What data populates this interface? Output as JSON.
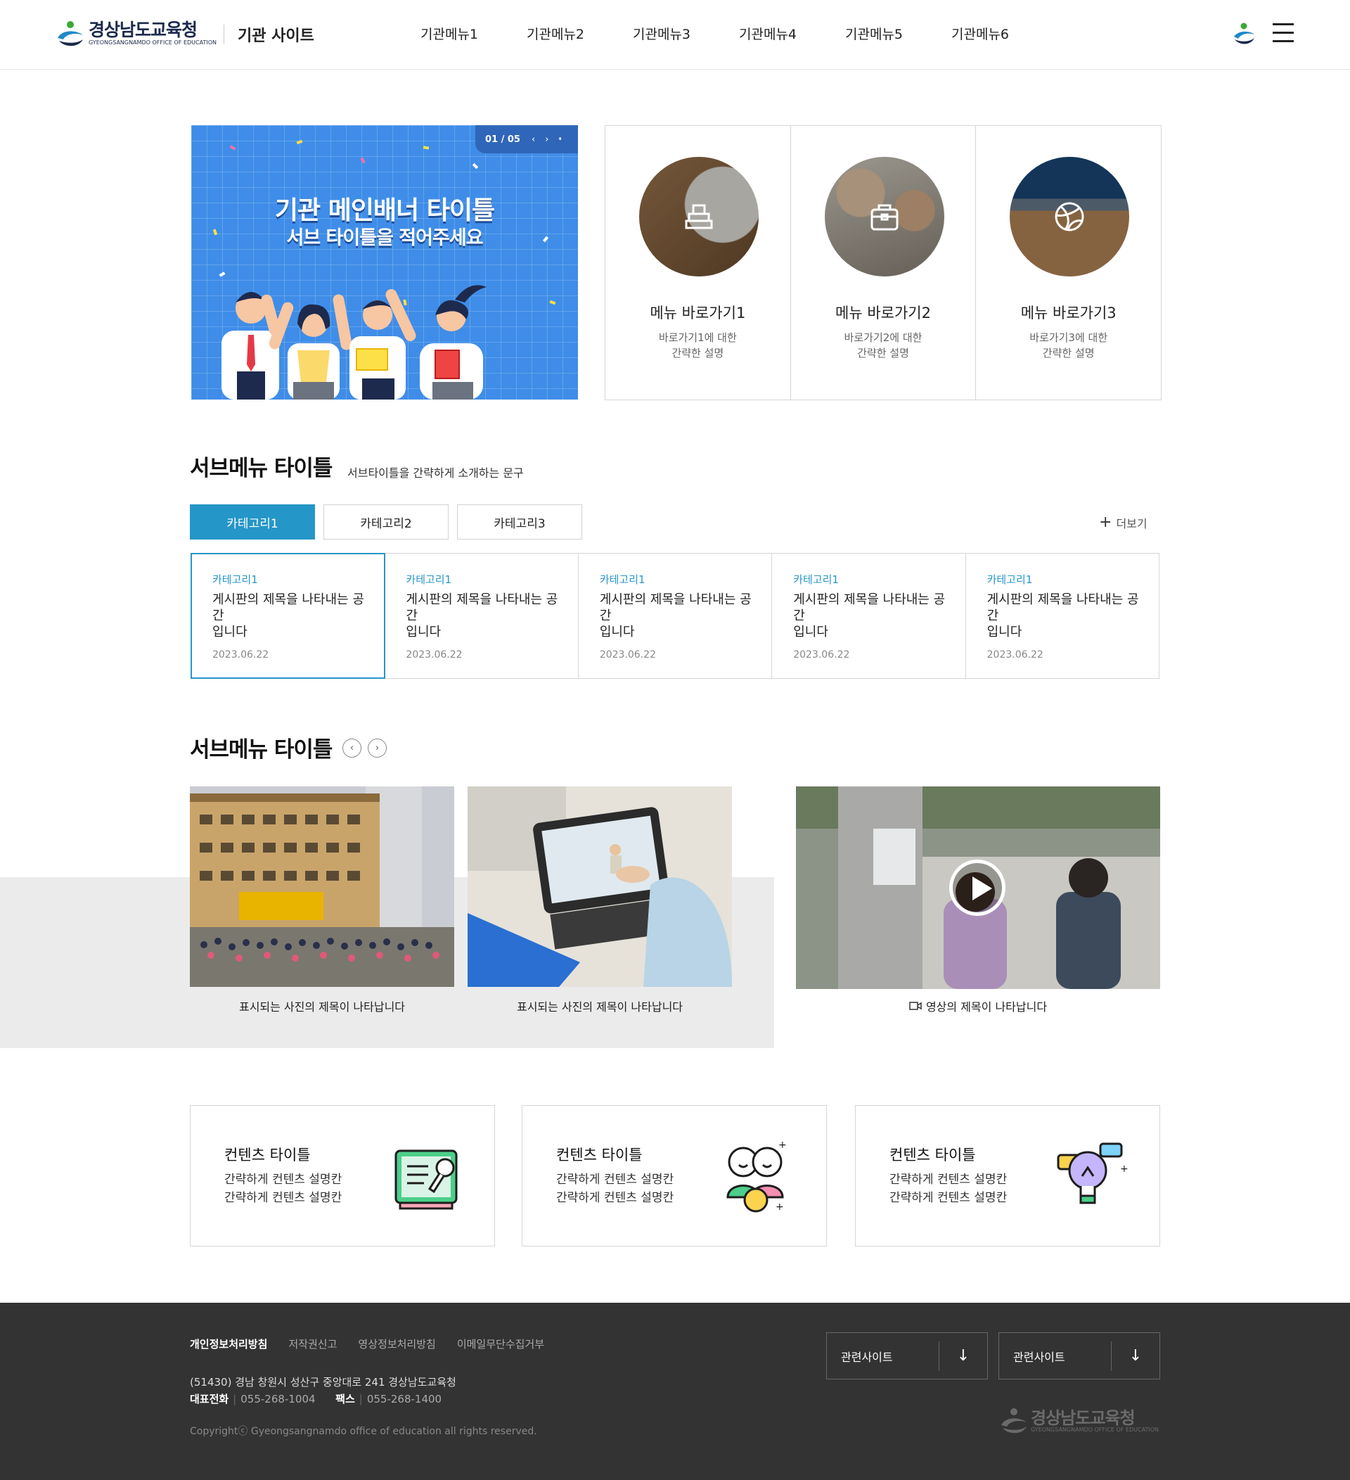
{
  "header": {
    "logo_ko": "경상남도교육청",
    "logo_en": "GYEONGSANGNAMDO OFFICE OF EDUCATION",
    "site_name": "기관 사이트",
    "gnb": [
      "기관메뉴1",
      "기관메뉴2",
      "기관메뉴3",
      "기관메뉴4",
      "기관메뉴5",
      "기관메뉴6"
    ]
  },
  "banner": {
    "page": "01 / 05",
    "prev_icon": "‹",
    "next_icon": "›",
    "pause_icon": "⏸",
    "title": "기관 메인배너 타이틀",
    "subtitle": "서브 타이틀을 적어주세요"
  },
  "quick_menu": [
    {
      "title": "메뉴 바로가기1",
      "desc_line1": "바로가기1에 대한",
      "desc_line2": "간략한 설명",
      "icon": "books-icon"
    },
    {
      "title": "메뉴 바로가기2",
      "desc_line1": "바로가기2에 대한",
      "desc_line2": "간략한 설명",
      "icon": "bag-icon"
    },
    {
      "title": "메뉴 바로가기3",
      "desc_line1": "바로가기3에 대한",
      "desc_line2": "간략한 설명",
      "icon": "ball-icon"
    }
  ],
  "board": {
    "title": "서브메뉴 타이틀",
    "desc": "서브타이틀을 간략하게 소개하는 문구",
    "tabs": [
      "카테고리1",
      "카테고리2",
      "카테고리3"
    ],
    "active_tab": 0,
    "more_label": "더보기",
    "posts": [
      {
        "category": "카테고리1",
        "title_line1": "게시판의 제목을 나타내는 공간",
        "title_line2": "입니다",
        "date": "2023.06.22"
      },
      {
        "category": "카테고리1",
        "title_line1": "게시판의 제목을 나타내는 공간",
        "title_line2": "입니다",
        "date": "2023.06.22"
      },
      {
        "category": "카테고리1",
        "title_line1": "게시판의 제목을 나타내는 공간",
        "title_line2": "입니다",
        "date": "2023.06.22"
      },
      {
        "category": "카테고리1",
        "title_line1": "게시판의 제목을 나타내는 공간",
        "title_line2": "입니다",
        "date": "2023.06.22"
      },
      {
        "category": "카테고리1",
        "title_line1": "게시판의 제목을 나타내는 공간",
        "title_line2": "입니다",
        "date": "2023.06.22"
      }
    ]
  },
  "gallery": {
    "title": "서브메뉴 타이틀",
    "prev": "‹",
    "next": "›",
    "photos": [
      {
        "caption": "표시되는 사진의 제목이 나타납니다"
      },
      {
        "caption": "표시되는 사진의 제목이 나타납니다"
      }
    ],
    "video": {
      "caption": "영상의 제목이 나타납니다"
    }
  },
  "cards": [
    {
      "title": "컨텐츠 타이틀",
      "line1": "간략하게 컨텐츠 설명칸",
      "line2": "간략하게 컨텐츠 설명칸",
      "icon": "board-icon"
    },
    {
      "title": "컨텐츠 타이틀",
      "line1": "간략하게 컨텐츠 설명칸",
      "line2": "간략하게 컨텐츠 설명칸",
      "icon": "friends-icon"
    },
    {
      "title": "컨텐츠 타이틀",
      "line1": "간략하게 컨텐츠 설명칸",
      "line2": "간략하게 컨텐츠 설명칸",
      "icon": "lightbulb-icon"
    }
  ],
  "footer": {
    "links": [
      "개인정보처리방침",
      "저작권신고",
      "영상정보처리방침",
      "이메일무단수집거부"
    ],
    "address": "(51430) 경남 창원시 성산구 중앙대로 241 경상남도교육청",
    "tel_label": "대표전화",
    "tel": "055-268-1004",
    "fax_label": "팩스",
    "fax": "055-268-1400",
    "copyright": "Copyrightⓒ Gyeongsangnamdo office of education all rights reserved.",
    "related1": "관련사이트",
    "related2": "관련사이트",
    "logo_ko": "경상남도교육청",
    "logo_en": "GYEONGSANGNAMDO OFFICE OF EDUCATION"
  },
  "colors": {
    "accent": "#2596c8",
    "banner": "#3f8de8",
    "footer_bg": "#333333"
  }
}
